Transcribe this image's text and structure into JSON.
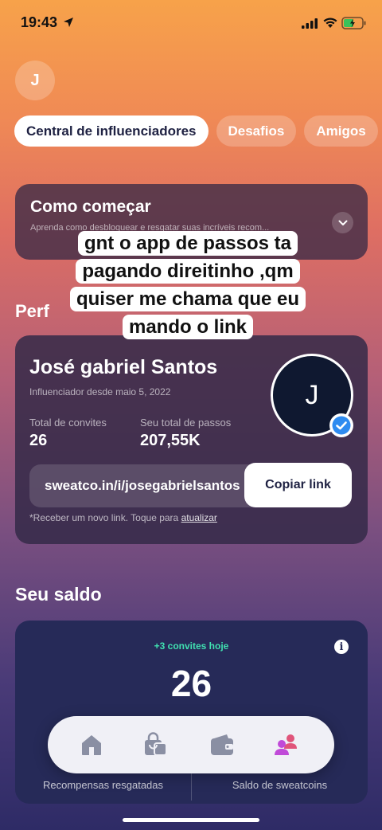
{
  "status_bar": {
    "time": "19:43"
  },
  "header": {
    "avatar_initial": "J"
  },
  "tabs": [
    {
      "label": "Central de influenciadores",
      "active": true
    },
    {
      "label": "Desafios",
      "active": false
    },
    {
      "label": "Amigos",
      "active": false
    }
  ],
  "how_to_start": {
    "title": "Como começar",
    "description": "Aprenda como desbloquear e resgatar suas incríveis recom..."
  },
  "profile_section_partial": "Perf",
  "overlay_caption": "gnt o app de passos ta pagando direitinho ,qm quiser me chama que eu mando o link",
  "profile": {
    "name": "José gabriel Santos",
    "since": "Influenciador desde maio 5, 2022",
    "invites_label": "Total de convites",
    "invites_value": "26",
    "steps_label": "Seu total de passos",
    "steps_value": "207,55K",
    "avatar_initial": "J",
    "link": "sweatco.in/i/josegabrielsantos",
    "copy_button": "Copiar link",
    "note_prefix": "*Receber um novo link. Toque para ",
    "note_link": "atualizar"
  },
  "balance": {
    "section_title": "Seu saldo",
    "invites_today": "+3 convites hoje",
    "value": "26",
    "left_label": "Recompensas resgatadas",
    "right_label": "Saldo de sweatcoins"
  },
  "bottom_nav": [
    {
      "icon": "home-icon",
      "active": false
    },
    {
      "icon": "shopping-bag-icon",
      "active": false
    },
    {
      "icon": "wallet-icon",
      "active": false
    },
    {
      "icon": "friends-icon",
      "active": true
    }
  ],
  "colors": {
    "accent_green": "#40e0b0",
    "verified_blue": "#2e8bf0",
    "nav_active": "#c04ad8",
    "nav_inactive": "#8a8fa3"
  }
}
